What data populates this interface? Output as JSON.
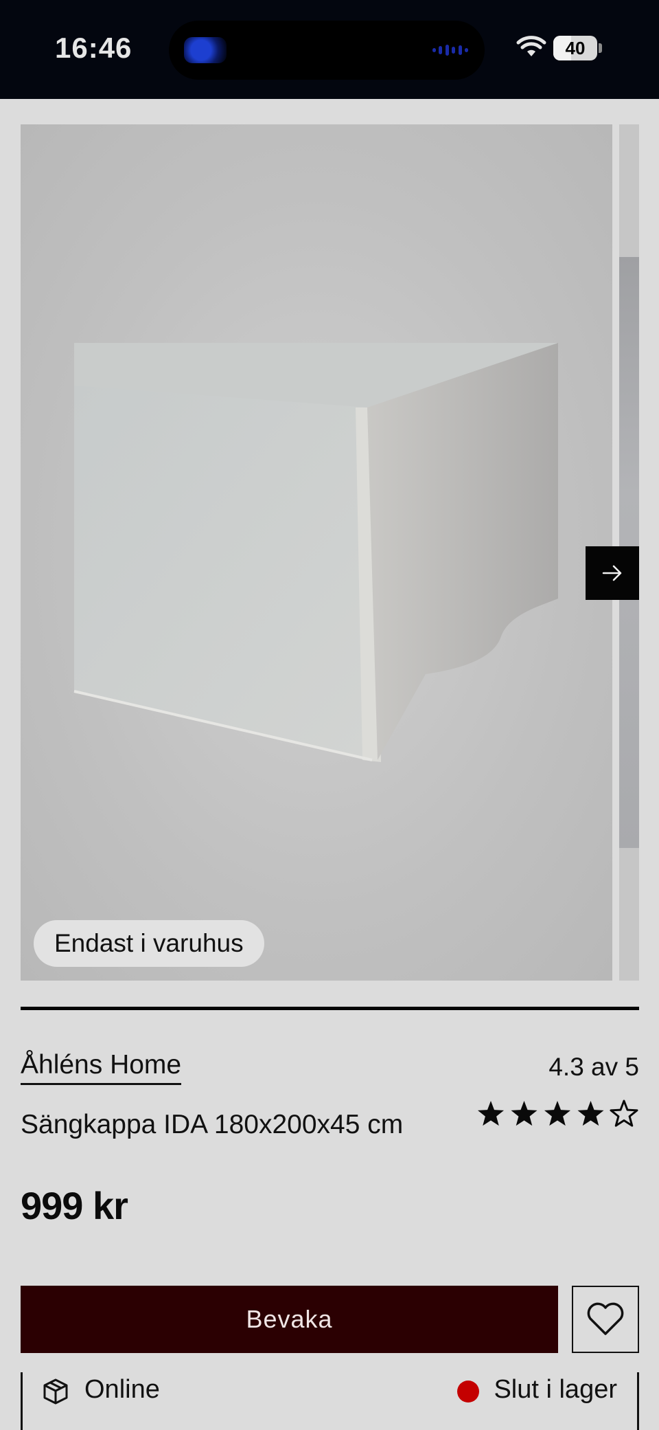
{
  "status_bar": {
    "time": "16:46",
    "battery": "40",
    "battery_level": 0.4,
    "icons": [
      "wifi-icon",
      "battery-icon"
    ]
  },
  "gallery": {
    "badge": "Endast i varuhus",
    "next_icon": "arrow-right-icon"
  },
  "product": {
    "brand": "Åhléns Home",
    "title": "Sängkappa IDA 180x200x45 cm",
    "rating_text": "4.3 av 5",
    "rating_value": 4.3,
    "rating_max": 5,
    "price": "999 kr"
  },
  "actions": {
    "watch_label": "Bevaka",
    "favorite_icon": "heart-icon",
    "accent_color": "#2b0002"
  },
  "availability": {
    "online_label": "Online",
    "online_icon": "box-icon",
    "stock_label": "Slut i lager",
    "stock_color": "#c40000"
  }
}
